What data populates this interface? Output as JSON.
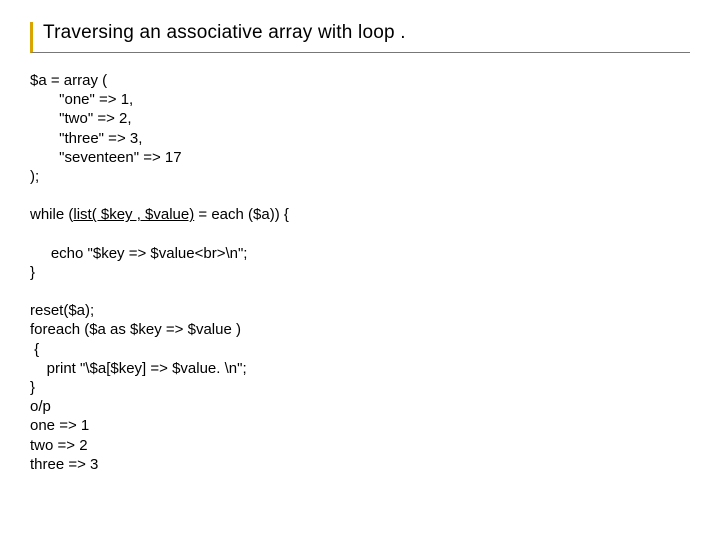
{
  "title": "Traversing an associative array with loop .",
  "code": {
    "l01": "$a = array (",
    "l02": "       \"one\" => 1,",
    "l03": "       \"two\" => 2,",
    "l04": "       \"three\" => 3,",
    "l05": "       \"seventeen\" => 17",
    "l06": ");",
    "l07": "",
    "l08_a": "while (",
    "l08_b": "list( $key , $value)",
    "l08_c": " = each ($a)) {",
    "l09": "",
    "l10": "     echo \"$key => $value<br>\\n\";",
    "l11": "}",
    "l12": "",
    "l13": "reset($a);",
    "l14": "foreach ($a as $key => $value )",
    "l15": " {",
    "l16": "    print \"\\$a[$key] => $value. \\n\";",
    "l17": "}",
    "l18": "o/p",
    "l19": "one => 1",
    "l20": "two => 2",
    "l21": "three => 3"
  }
}
